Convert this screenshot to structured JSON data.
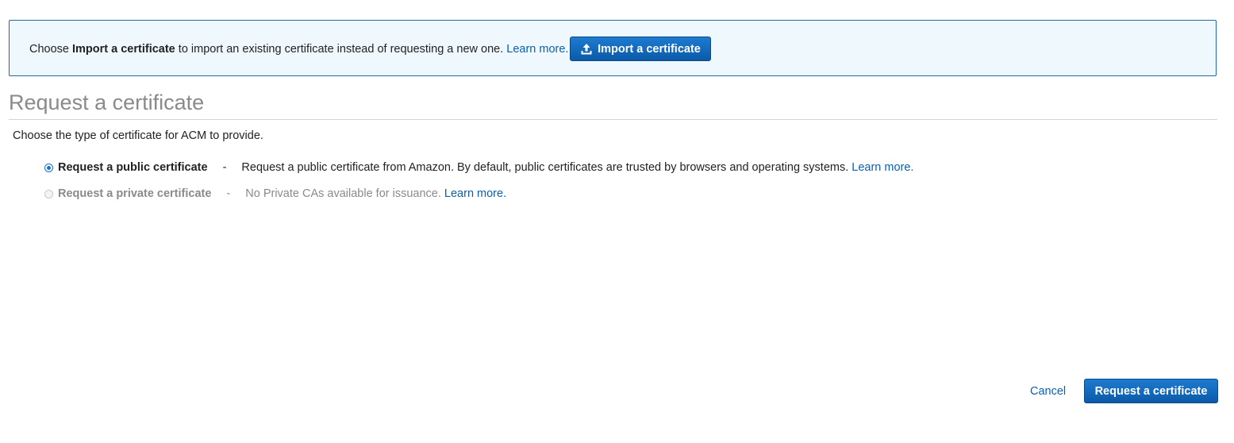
{
  "banner": {
    "text_prefix": "Choose ",
    "text_bold": "Import a certificate",
    "text_suffix": " to import an existing certificate instead of requesting a new one.",
    "learn_more": "Learn more.",
    "import_button": "Import a certificate",
    "import_icon": "upload-icon"
  },
  "page": {
    "title": "Request a certificate",
    "description": "Choose the type of certificate for ACM to provide."
  },
  "options": [
    {
      "label": "Request a public certificate",
      "separator": "-",
      "description": "Request a public certificate from Amazon. By default, public certificates are trusted by browsers and operating systems.",
      "learn_more": "Learn more.",
      "selected": true,
      "disabled": false
    },
    {
      "label": "Request a private certificate",
      "separator": "-",
      "description": "No Private CAs available for issuance.",
      "learn_more": "Learn more.",
      "selected": false,
      "disabled": true
    }
  ],
  "footer": {
    "cancel": "Cancel",
    "submit": "Request a certificate"
  },
  "colors": {
    "accent": "#0b5aa8",
    "link": "#0a60b0",
    "banner_bg": "#eef8fd",
    "banner_border": "#1f6aa0"
  }
}
